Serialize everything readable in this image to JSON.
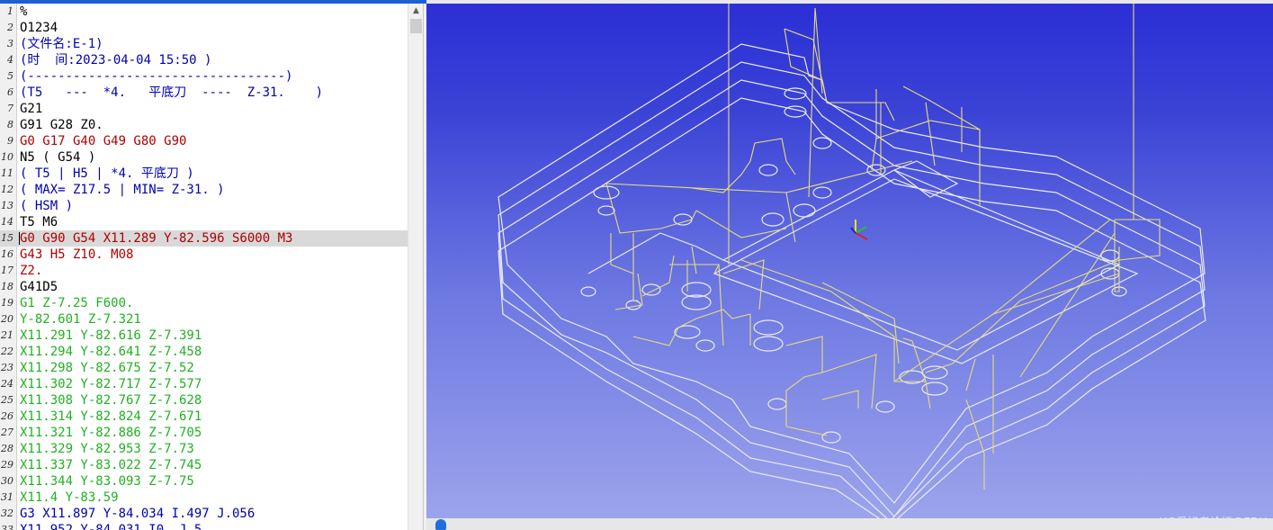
{
  "editor": {
    "lines": [
      {
        "n": "1",
        "text": "%",
        "color": "black"
      },
      {
        "n": "2",
        "text": "O1234",
        "color": "black"
      },
      {
        "n": "3",
        "text": "(文件名:E-1)",
        "color": "blue"
      },
      {
        "n": "4",
        "text": "(时  间:2023-04-04 15:50 )",
        "color": "blue"
      },
      {
        "n": "5",
        "text": "(----------------------------------)",
        "color": "blue"
      },
      {
        "n": "6",
        "text": "(T5   ---  *4.   平底刀  ----  Z-31.    )",
        "color": "blue"
      },
      {
        "n": "7",
        "text": "G21",
        "color": "black"
      },
      {
        "n": "8",
        "text": "G91 G28 Z0.",
        "color": "black"
      },
      {
        "n": "9",
        "text": "G0 G17 G40 G49 G80 G90",
        "color": "red"
      },
      {
        "n": "10",
        "text": "N5 ( G54 )",
        "color": "black"
      },
      {
        "n": "11",
        "text": "( T5 | H5 | *4. 平底刀 )",
        "color": "blue"
      },
      {
        "n": "12",
        "text": "( MAX= Z17.5 | MIN= Z-31. )",
        "color": "blue"
      },
      {
        "n": "13",
        "text": "( HSM )",
        "color": "blue"
      },
      {
        "n": "14",
        "text": "T5 M6",
        "color": "black"
      },
      {
        "n": "15",
        "text": "G0 G90 G54 X11.289 Y-82.596 S6000 M3",
        "color": "red",
        "selected": true
      },
      {
        "n": "16",
        "text": "G43 H5 Z10. M08",
        "color": "red"
      },
      {
        "n": "17",
        "text": "Z2.",
        "color": "red"
      },
      {
        "n": "18",
        "text": "G41D5",
        "color": "black"
      },
      {
        "n": "19",
        "text": "G1 Z-7.25 F600.",
        "color": "green"
      },
      {
        "n": "20",
        "text": "Y-82.601 Z-7.321",
        "color": "green"
      },
      {
        "n": "21",
        "text": "X11.291 Y-82.616 Z-7.391",
        "color": "green"
      },
      {
        "n": "22",
        "text": "X11.294 Y-82.641 Z-7.458",
        "color": "green"
      },
      {
        "n": "23",
        "text": "X11.298 Y-82.675 Z-7.52",
        "color": "green"
      },
      {
        "n": "24",
        "text": "X11.302 Y-82.717 Z-7.577",
        "color": "green"
      },
      {
        "n": "25",
        "text": "X11.308 Y-82.767 Z-7.628",
        "color": "green"
      },
      {
        "n": "26",
        "text": "X11.314 Y-82.824 Z-7.671",
        "color": "green"
      },
      {
        "n": "27",
        "text": "X11.321 Y-82.886 Z-7.705",
        "color": "green"
      },
      {
        "n": "28",
        "text": "X11.329 Y-82.953 Z-7.73",
        "color": "green"
      },
      {
        "n": "29",
        "text": "X11.337 Y-83.022 Z-7.745",
        "color": "green"
      },
      {
        "n": "30",
        "text": "X11.344 Y-83.093 Z-7.75",
        "color": "green"
      },
      {
        "n": "31",
        "text": "X11.4 Y-83.59",
        "color": "green"
      },
      {
        "n": "32",
        "text": "G3 X11.897 Y-84.034 I.497 J.056",
        "color": "blue"
      },
      {
        "n": "33",
        "text": "X11.952 Y-84.031 I0. J.5",
        "color": "blue"
      }
    ]
  },
  "viewport": {
    "watermark": "UG爱好者论坛@FDU",
    "toolpath_color": "#e6dc7a",
    "outline_color": "#eaeaf2",
    "background_top": "#2b2fd6",
    "background_bottom": "#9ea6ec"
  },
  "scrollbar": {
    "up_arrow_icon": "▲"
  }
}
